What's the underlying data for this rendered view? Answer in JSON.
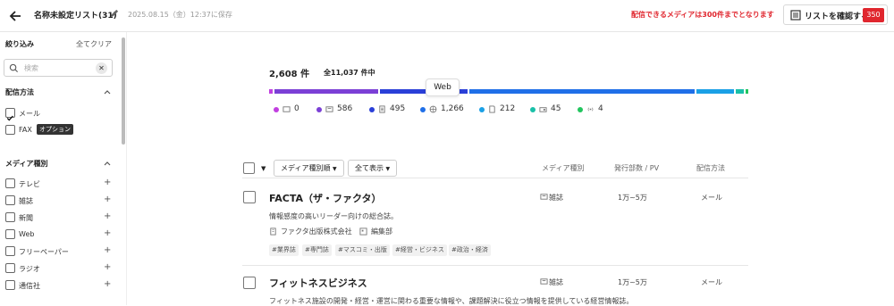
{
  "header": {
    "title": "名称未設定リスト(31)",
    "saved": "2025.08.15（金）12:37に保存",
    "warning": "配信できるメディアは300件までとなります",
    "confirm_label": "リストを確認する",
    "count": "350"
  },
  "sidebar": {
    "filter_title": "絞り込み",
    "clear_all": "全てクリア",
    "search_placeholder": "検索",
    "method_title": "配信方法",
    "methods": [
      {
        "label": "メール",
        "checked": true
      },
      {
        "label": "FAX",
        "checked": false,
        "badge": "オプション"
      }
    ],
    "media_title": "メディア種別",
    "media_types": [
      "テレビ",
      "雑誌",
      "新聞",
      "Web",
      "フリーペーパー",
      "ラジオ",
      "通信社"
    ]
  },
  "summary": {
    "total": "2,608 件",
    "overall": "全11,037 件中",
    "tooltip": "Web",
    "legend": [
      {
        "value": "0",
        "color": "#c13fe0",
        "icon": "tv-icon"
      },
      {
        "value": "586",
        "color": "#7b3fd6",
        "icon": "magazine-icon"
      },
      {
        "value": "495",
        "color": "#2a3fd8",
        "icon": "newspaper-icon"
      },
      {
        "value": "1,266",
        "color": "#1f6fe8",
        "icon": "web-icon"
      },
      {
        "value": "212",
        "color": "#1aa0e6",
        "icon": "freepaper-icon"
      },
      {
        "value": "45",
        "color": "#19c0a8",
        "icon": "radio-icon"
      },
      {
        "value": "4",
        "color": "#22c55e",
        "icon": "broadcast-icon"
      }
    ]
  },
  "table": {
    "sort_label": "メディア種別順",
    "filter_label": "全て表示",
    "col_type": "メディア種別",
    "col_circulation": "発行部数 / PV",
    "col_method": "配信方法"
  },
  "rows": [
    {
      "title": "FACTA（ザ・ファクタ）",
      "description": "情報感度の高いリーダー向けの総合誌。",
      "type": "雑誌",
      "circulation": "1万~5万",
      "method": "メール",
      "publisher": "ファクタ出版株式会社",
      "department": "編集部",
      "tags": [
        "#業界誌",
        "#専門誌",
        "#マスコミ・出版",
        "#経営・ビジネス",
        "#政治・経済"
      ]
    },
    {
      "title": "フィットネスビジネス",
      "description": "フィットネス施設の開発・経営・運営に関わる重要な情報や、課題解決に役立つ情報を提供している経営情報誌。",
      "type": "雑誌",
      "circulation": "1万~5万",
      "method": "メール"
    }
  ]
}
